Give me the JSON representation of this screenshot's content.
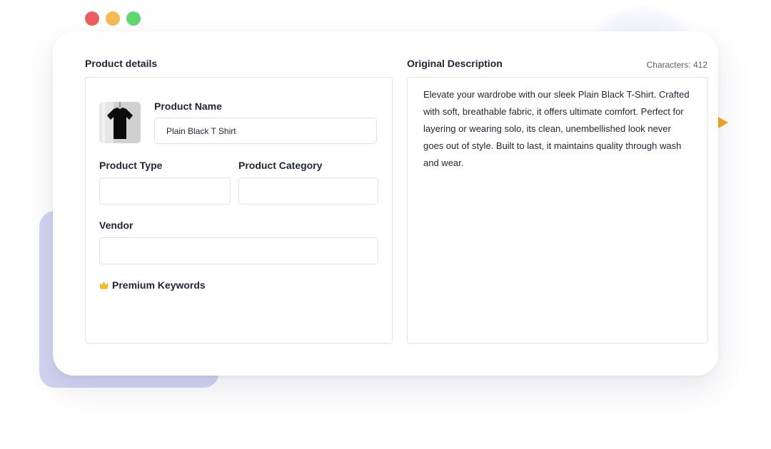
{
  "window": {
    "dot_colors": [
      "#ec5f61",
      "#f5bc53",
      "#5fd96f"
    ]
  },
  "product_details": {
    "title": "Product details",
    "product_name": {
      "label": "Product Name",
      "value": "Plain Black T Shirt"
    },
    "product_type": {
      "label": "Product Type",
      "value": ""
    },
    "product_category": {
      "label": "Product Category",
      "value": ""
    },
    "vendor": {
      "label": "Vendor",
      "value": ""
    },
    "premium_keywords": {
      "label": "Premium Keywords",
      "icon": "crown-icon"
    }
  },
  "original_description": {
    "title": "Original Description",
    "characters": "Characters: 412",
    "text": "Elevate your wardrobe with our sleek Plain Black T-Shirt. Crafted with soft, breathable fabric, it offers ultimate comfort. Perfect for layering or wearing solo, its clean, unembellished look never goes out of style. Built to last, it maintains quality through wash and wear."
  },
  "colors": {
    "accent_triangle": "#f5a623",
    "background_block": "#d2d5f1",
    "crown": "#f7c21a"
  }
}
